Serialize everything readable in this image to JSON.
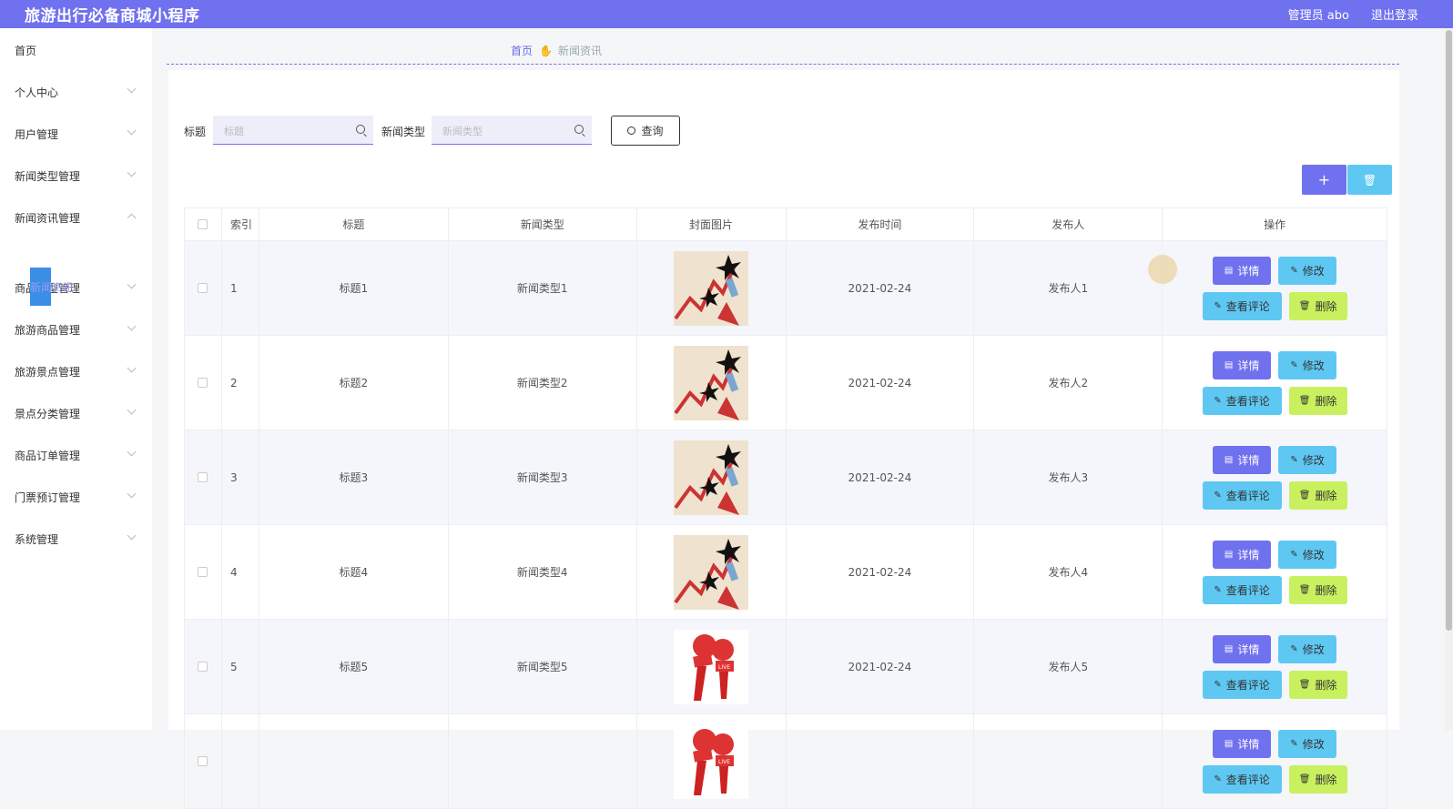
{
  "header": {
    "title": "旅游出行必备商城小程序",
    "user": "管理员 abo",
    "logout": "退出登录"
  },
  "sidebar": {
    "items": [
      {
        "label": "首页",
        "chevron": false
      },
      {
        "label": "个人中心",
        "chevron": true
      },
      {
        "label": "用户管理",
        "chevron": true
      },
      {
        "label": "新闻类型管理",
        "chevron": true
      },
      {
        "label": "新闻资讯管理",
        "chevron": true,
        "expanded": true
      },
      {
        "label": "商品类型管理",
        "chevron": true
      },
      {
        "label": "旅游商品管理",
        "chevron": true
      },
      {
        "label": "旅游景点管理",
        "chevron": true
      },
      {
        "label": "景点分类管理",
        "chevron": true
      },
      {
        "label": "商品订单管理",
        "chevron": true
      },
      {
        "label": "门票预订管理",
        "chevron": true
      },
      {
        "label": "系统管理",
        "chevron": true
      }
    ],
    "active_sub": "新闻资讯"
  },
  "breadcrumb": {
    "home": "首页",
    "current": "新闻资讯"
  },
  "search": {
    "title_label": "标题",
    "title_placeholder": "标题",
    "type_label": "新闻类型",
    "type_placeholder": "新闻类型",
    "query_label": "查询"
  },
  "toolbar": {
    "add_icon": "+",
    "delete_icon": "🗑"
  },
  "table": {
    "columns": [
      "索引",
      "标题",
      "新闻类型",
      "封面图片",
      "发布时间",
      "发布人",
      "操作"
    ],
    "rows": [
      {
        "index": "1",
        "title": "标题1",
        "type": "新闻类型1",
        "cover": "chart-arrow",
        "date": "2021-02-24",
        "author": "发布人1"
      },
      {
        "index": "2",
        "title": "标题2",
        "type": "新闻类型2",
        "cover": "chart-arrow",
        "date": "2021-02-24",
        "author": "发布人2"
      },
      {
        "index": "3",
        "title": "标题3",
        "type": "新闻类型3",
        "cover": "chart-arrow",
        "date": "2021-02-24",
        "author": "发布人3"
      },
      {
        "index": "4",
        "title": "标题4",
        "type": "新闻类型4",
        "cover": "chart-arrow",
        "date": "2021-02-24",
        "author": "发布人4"
      },
      {
        "index": "5",
        "title": "标题5",
        "type": "新闻类型5",
        "cover": "microphone",
        "date": "2021-02-24",
        "author": "发布人5"
      },
      {
        "index": "",
        "title": "",
        "type": "",
        "cover": "microphone",
        "date": "",
        "author": ""
      }
    ],
    "actions": {
      "detail": "详情",
      "edit": "修改",
      "comments": "查看评论",
      "delete": "删除"
    }
  },
  "colors": {
    "primary": "#7071ef",
    "info": "#5ec8f3",
    "warn": "#c9f05f",
    "active_sub": "#3a8ee6"
  }
}
